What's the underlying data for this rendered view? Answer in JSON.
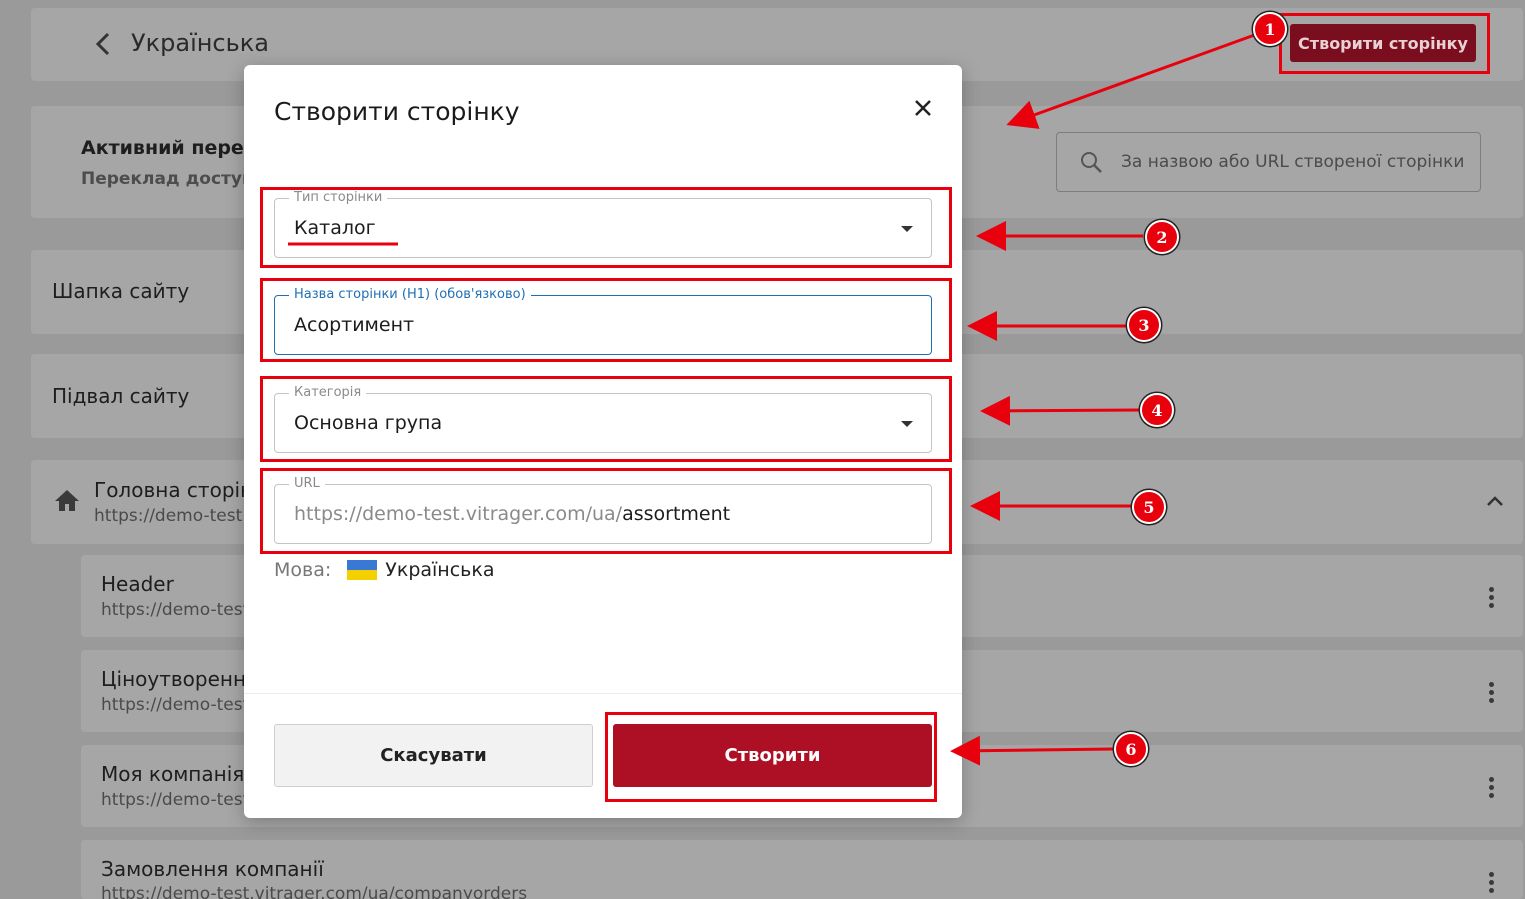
{
  "header": {
    "back_label": "Українська",
    "create_page_button": "Створити сторінку"
  },
  "search": {
    "placeholder": "За назвою або URL створеної сторінки"
  },
  "translation": {
    "title_partial": "Активний перекл",
    "subtitle_partial": "Переклад доступн"
  },
  "sections": {
    "site_header": "Шапка сайту",
    "site_footer": "Підвал сайту"
  },
  "home_page": {
    "title_partial": "Головна сторінк",
    "url_partial": "https://demo-test.v"
  },
  "pages": [
    {
      "title": "Header",
      "url": "https://demo-test"
    },
    {
      "title": "Ціноутворення",
      "url": "https://demo-test"
    },
    {
      "title": "Моя компанія",
      "url": "https://demo-test"
    },
    {
      "title": "Замовлення компанії",
      "url": "https://demo-test.vitrager.com/ua/companyorders"
    }
  ],
  "modal": {
    "title": "Створити сторінку",
    "page_type": {
      "label": "Тип сторінки",
      "value": "Каталог"
    },
    "page_name": {
      "label": "Назва сторінки (H1) (обов'язково)",
      "value": "Асортимент"
    },
    "category": {
      "label": "Категорія",
      "value": "Основна група"
    },
    "url": {
      "label": "URL",
      "prefix": "https://demo-test.vitrager.com/ua/",
      "slug": "assortment"
    },
    "language": {
      "label": "Мова:",
      "value": "Українська"
    },
    "cancel_button": "Скасувати",
    "create_button": "Створити"
  },
  "annotations": [
    "1",
    "2",
    "3",
    "4",
    "5",
    "6"
  ],
  "colors": {
    "brand": "#ad0f25",
    "annotation": "#e8000d",
    "focus": "#1f6fb5"
  }
}
